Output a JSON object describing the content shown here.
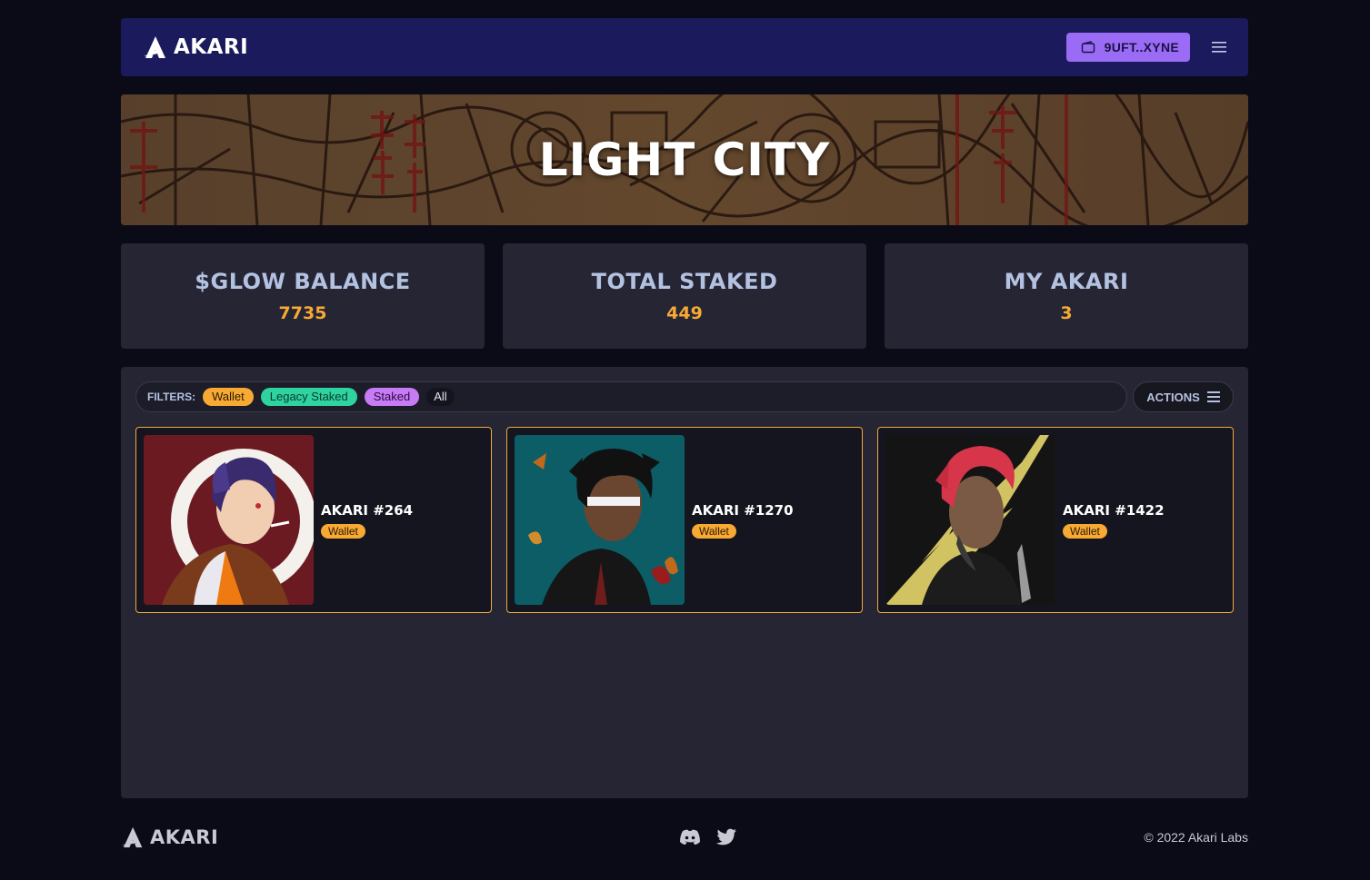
{
  "header": {
    "logo_text": "AKARI",
    "wallet_label": "9UFT..XYNE"
  },
  "banner": {
    "title": "LIGHT CITY"
  },
  "stats": [
    {
      "label": "$GLOW BALANCE",
      "value": "7735"
    },
    {
      "label": "TOTAL STAKED",
      "value": "449"
    },
    {
      "label": "MY AKARI",
      "value": "3"
    }
  ],
  "filters": {
    "label": "FILTERS:",
    "chips": [
      "Wallet",
      "Legacy Staked",
      "Staked",
      "All"
    ]
  },
  "actions": {
    "label": "ACTIONS"
  },
  "cards": [
    {
      "title": "AKARI #264",
      "badge": "Wallet"
    },
    {
      "title": "AKARI #1270",
      "badge": "Wallet"
    },
    {
      "title": "AKARI #1422",
      "badge": "Wallet"
    }
  ],
  "footer": {
    "logo_text": "AKARI",
    "copyright": "© 2022 Akari Labs"
  },
  "colors": {
    "accent": "#9a6cf5",
    "value": "#f7a934",
    "card_border": "#f2a93b",
    "header_bg": "#1a1a5c"
  },
  "icons": [
    "akari-logo-icon",
    "wallet-icon",
    "hamburger-menu-icon",
    "discord-icon",
    "twitter-icon"
  ]
}
